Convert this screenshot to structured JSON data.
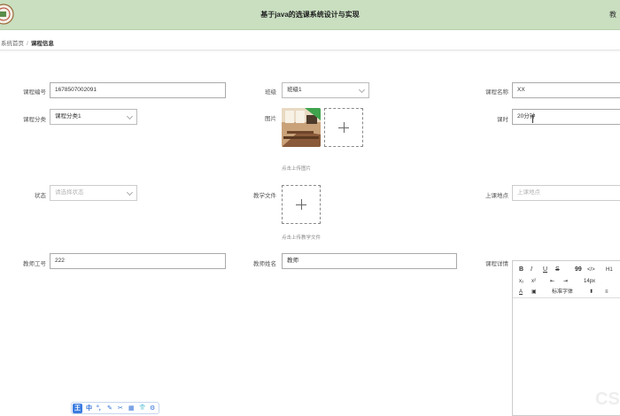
{
  "header": {
    "title": "基于java的选课系统设计与实现",
    "user_fragment": "教"
  },
  "breadcrumb": {
    "home": "系统首页",
    "separator": "/",
    "current": "课程信息"
  },
  "form": {
    "course_code": {
      "label": "课程编号",
      "value": "1678507002091"
    },
    "class": {
      "label": "班级",
      "value": "班级1"
    },
    "course_name": {
      "label": "课程名称",
      "value": "XX"
    },
    "category": {
      "label": "课程分类",
      "value": "课程分类1"
    },
    "picture": {
      "label": "图片",
      "hint": "点击上传图片"
    },
    "hours": {
      "label": "课时",
      "value": "20分钟"
    },
    "status": {
      "label": "状态",
      "placeholder": "请选择状态"
    },
    "teaching_file": {
      "label": "教学文件",
      "hint": "点击上传教学文件"
    },
    "location": {
      "label": "上课地点",
      "placeholder": "上课地点"
    },
    "teacher_id": {
      "label": "教师工号",
      "value": "222"
    },
    "teacher_name": {
      "label": "教师姓名",
      "value": "教师"
    },
    "details": {
      "label": "课程详情"
    }
  },
  "editor": {
    "row1": [
      "B",
      "I",
      "U",
      "S",
      "99",
      "</>",
      "H1"
    ],
    "row2": [
      "x₂",
      "x²",
      "⇤",
      "⇥",
      "14px"
    ],
    "row3": [
      "A",
      "▣",
      "标准字体",
      "≡"
    ]
  },
  "watermark": "CS",
  "ime": {
    "logo": "王",
    "items": [
      "中",
      "°,",
      "✎",
      "✂",
      "▦",
      "👕",
      "⚙"
    ]
  },
  "colors": {
    "header_bg": "#c9dfc0",
    "ime_accent": "#3b7be0"
  }
}
